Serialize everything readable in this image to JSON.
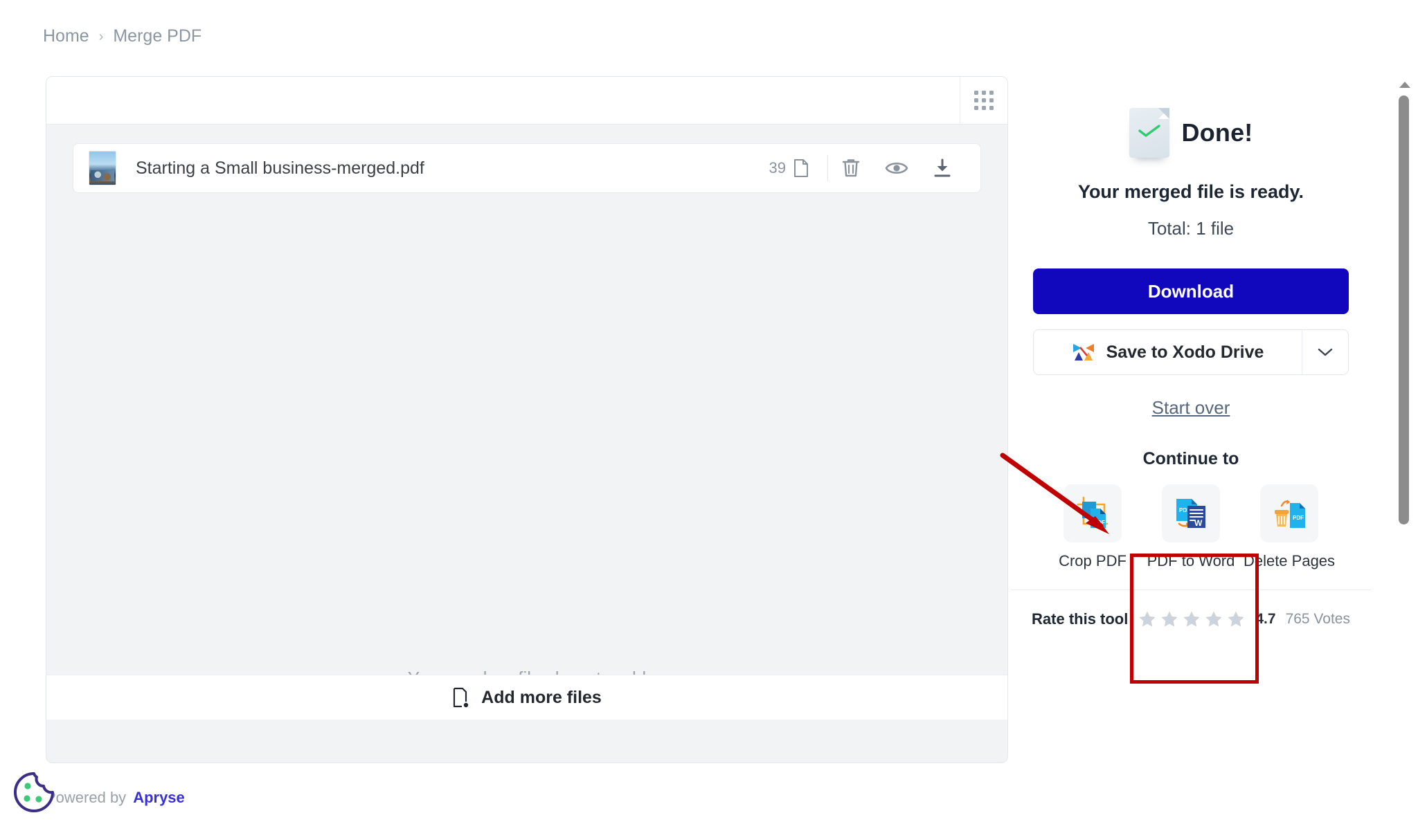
{
  "breadcrumb": {
    "home": "Home",
    "separator": "›",
    "current": "Merge PDF"
  },
  "file_panel": {
    "toolbar": {
      "grid_view_icon": "grid-icon"
    },
    "file": {
      "name": "Starting a Small business-merged.pdf",
      "page_count": "39",
      "page_icon": "page-icon",
      "delete_icon": "trash-icon",
      "preview_icon": "eye-icon",
      "download_icon": "download-icon",
      "thumbnail": "pdf-page-thumbnail"
    },
    "drop_hint": "You can drop files here to add",
    "add_more_label": "Add more files",
    "add_more_icon": "file-plus-icon"
  },
  "result_panel": {
    "status_icon": "document-check-icon",
    "title": "Done!",
    "ready_text": "Your merged file is ready.",
    "total_text": "Total: 1 file",
    "download_label": "Download",
    "xodo_label": "Save to Xodo Drive",
    "xodo_icon": "xodo-logo-icon",
    "xodo_caret_icon": "chevron-down-icon",
    "start_over_label": "Start over",
    "continue_heading": "Continue to",
    "tools": [
      {
        "label": "Crop PDF",
        "icon": "crop-pdf-icon"
      },
      {
        "label": "PDF to Word",
        "icon": "pdf-to-word-icon"
      },
      {
        "label": "Delete Pages",
        "icon": "delete-pages-icon"
      }
    ],
    "rate": {
      "label": "Rate this tool",
      "stars": 5,
      "star_icon": "star-icon",
      "value": "4.7",
      "votes": "765 Votes"
    }
  },
  "scrollbar": {
    "up_arrow_icon": "scroll-up-arrow-icon",
    "thumb": "scrollbar-thumb"
  },
  "annotation": {
    "arrow": "red-arrow-annotation",
    "highlight_box": "red-highlight-box",
    "highlight_target": "PDF to Word",
    "color": "#c00000"
  },
  "footer": {
    "powered_by": "Powered by",
    "brand": "Apryse",
    "cookie_icon": "cookie-consent-icon"
  },
  "colors": {
    "download_button": "#1108bd",
    "panel_background": "#f1f3f5",
    "annotation_red": "#c00000",
    "brand_blue": "#3730d8"
  }
}
